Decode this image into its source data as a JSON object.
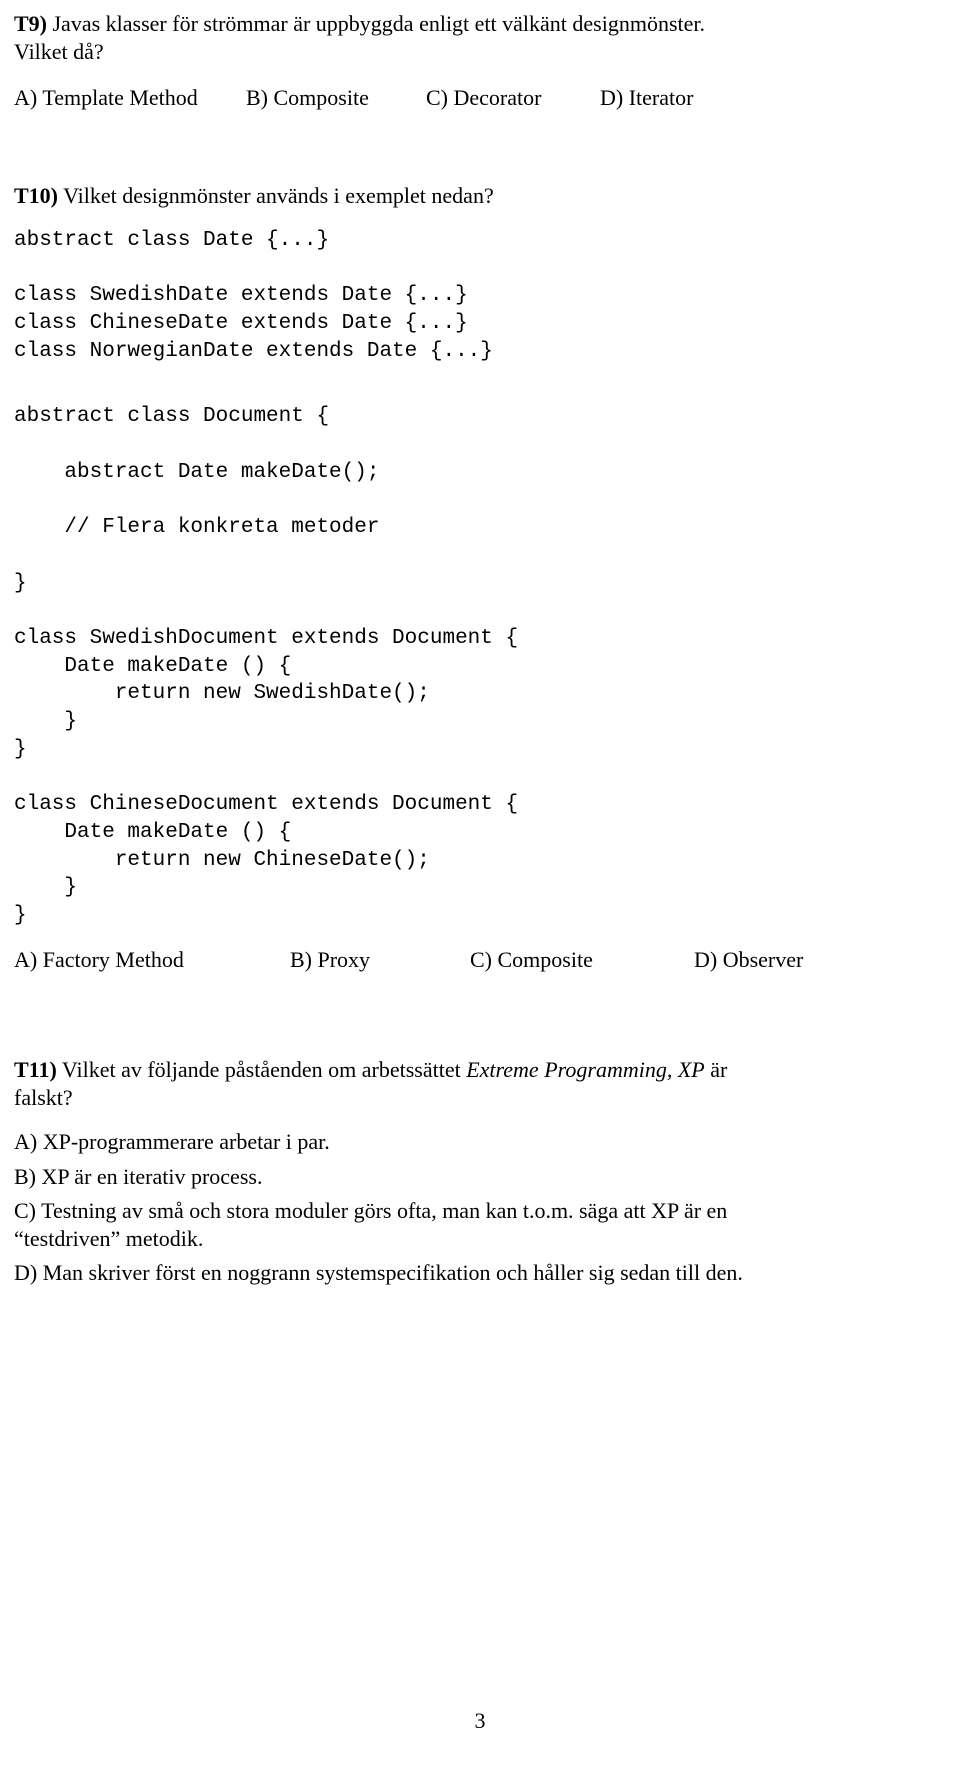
{
  "q9": {
    "label": "T9)",
    "text_line1": " Javas klasser för strömmar är uppbyggda enligt ett välkänt designmönster.",
    "text_line2": "Vilket då?",
    "options": {
      "a": "A) Template Method",
      "b": "B) Composite",
      "c": "C) Decorator",
      "d": "D) Iterator"
    }
  },
  "q10": {
    "label": "T10)",
    "text": " Vilket designmönster används i exemplet nedan?",
    "code_block1": "abstract class Date {...}\n\nclass SwedishDate extends Date {...}\nclass ChineseDate extends Date {...}\nclass NorwegianDate extends Date {...}",
    "code_block2": "abstract class Document {\n\n    abstract Date makeDate();\n\n    // Flera konkreta metoder\n\n}\n\nclass SwedishDocument extends Document {\n    Date makeDate () {\n        return new SwedishDate();\n    }\n}\n\nclass ChineseDocument extends Document {\n    Date makeDate () {\n        return new ChineseDate();\n    }\n}",
    "options": {
      "a": "A) Factory Method",
      "b": "B) Proxy",
      "c": "C) Composite",
      "d": "D) Observer"
    }
  },
  "q11": {
    "label": "T11)",
    "text_part1": " Vilket av följande påståenden om arbetssättet ",
    "text_italic": "Extreme Programming, XP",
    "text_part2": " är",
    "text_line2": "falskt?",
    "opt_a": "A) XP-programmerare arbetar i par.",
    "opt_b": "B) XP är en iterativ process.",
    "opt_c_l1": "C) Testning av små och stora moduler görs ofta, man kan t.o.m. säga att XP är en",
    "opt_c_l2": "“testdriven” metodik.",
    "opt_d": "D) Man skriver först en noggrann systemspecifikation och håller sig sedan till den."
  },
  "page_number": "3"
}
